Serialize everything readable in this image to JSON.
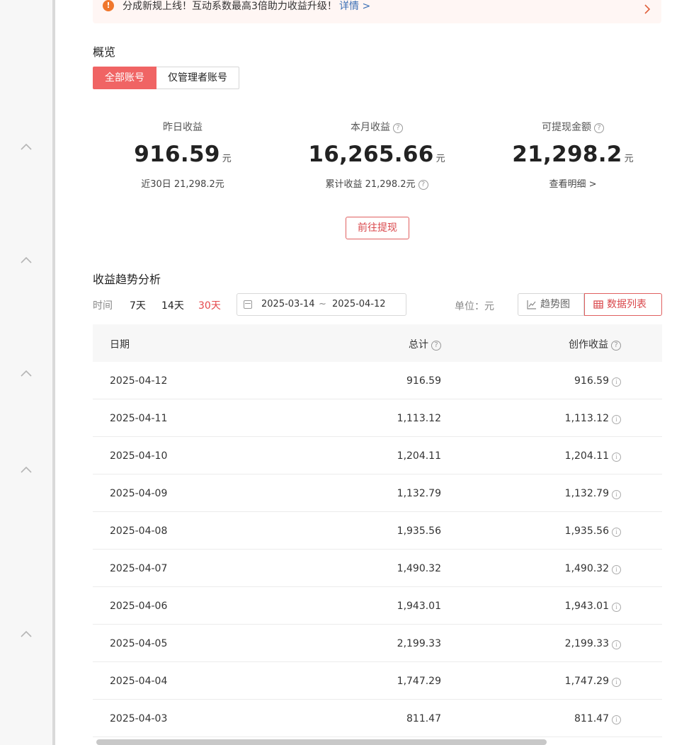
{
  "notice": {
    "icon": "warning-icon",
    "message": "分成新规上线！互动系数最高3倍助力收益升级！",
    "detail_link": "详情 >"
  },
  "overview": {
    "title": "概览",
    "tabs": [
      "全部账号",
      "仅管理者账号"
    ],
    "active_tab": "全部账号",
    "stats": [
      {
        "label": "昨日收益",
        "value": "916.59",
        "unit": "元",
        "sub": "近30日 21,298.2元"
      },
      {
        "label": "本月收益",
        "value": "16,265.66",
        "unit": "元",
        "sub": "累计收益 21,298.2元"
      },
      {
        "label": "可提现金额",
        "value": "21,298.2",
        "unit": "元",
        "sub": "查看明细 >"
      }
    ],
    "withdraw_button": "前往提现"
  },
  "trend": {
    "title": "收益趋势分析",
    "time_label": "时间",
    "ranges": [
      "7天",
      "14天",
      "30天"
    ],
    "active_range": "30天",
    "date_start": "2025-03-14",
    "date_sep": "~",
    "date_end": "2025-04-12",
    "unit_label": "单位：元",
    "view_buttons": [
      "趋势图",
      "数据列表"
    ],
    "active_view": "数据列表"
  },
  "table": {
    "headers": {
      "date": "日期",
      "total": "总计",
      "creation": "创作收益"
    },
    "rows": [
      {
        "date": "2025-04-12",
        "total": "916.59",
        "creation": "916.59"
      },
      {
        "date": "2025-04-11",
        "total": "1,113.12",
        "creation": "1,113.12"
      },
      {
        "date": "2025-04-10",
        "total": "1,204.11",
        "creation": "1,204.11"
      },
      {
        "date": "2025-04-09",
        "total": "1,132.79",
        "creation": "1,132.79"
      },
      {
        "date": "2025-04-08",
        "total": "1,935.56",
        "creation": "1,935.56"
      },
      {
        "date": "2025-04-07",
        "total": "1,490.32",
        "creation": "1,490.32"
      },
      {
        "date": "2025-04-06",
        "total": "1,943.01",
        "creation": "1,943.01"
      },
      {
        "date": "2025-04-05",
        "total": "2,199.33",
        "creation": "2,199.33"
      },
      {
        "date": "2025-04-04",
        "total": "1,747.29",
        "creation": "1,747.29"
      },
      {
        "date": "2025-04-03",
        "total": "811.47",
        "creation": "811.47"
      }
    ]
  },
  "colors": {
    "accent": "#f06464",
    "accent_text": "#d9464a",
    "link": "#3a6fb5",
    "warning": "#f0772d"
  }
}
